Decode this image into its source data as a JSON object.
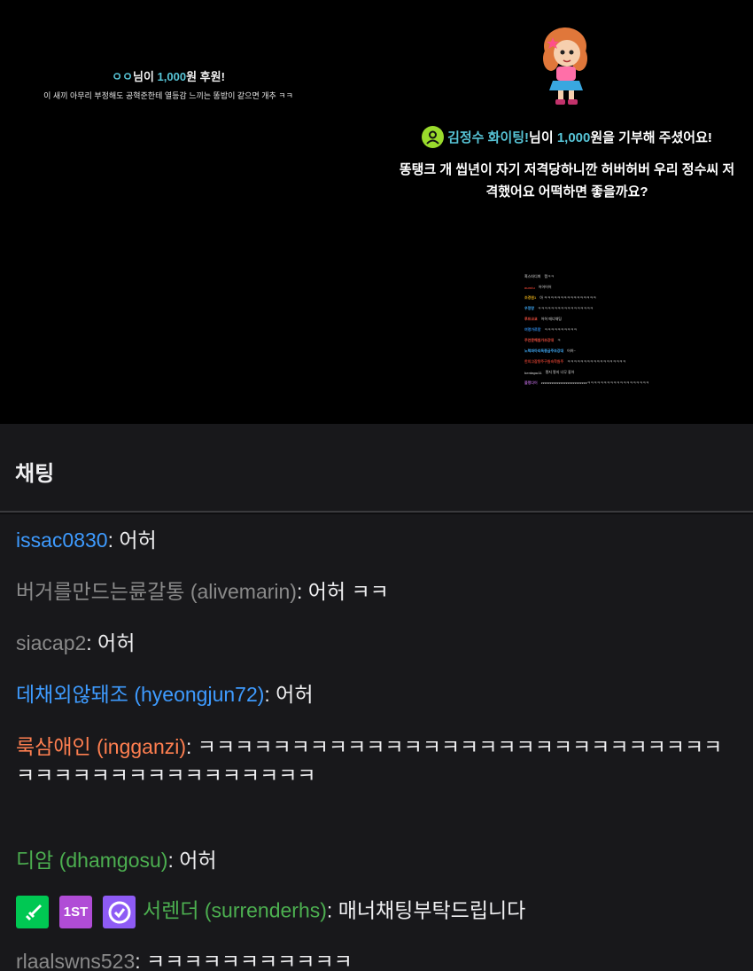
{
  "stream": {
    "alert_left": {
      "name": "ㅇㅇ",
      "mid": "님이 ",
      "amount": "1,000",
      "suffix": "원 후원!",
      "message": "이 새끼 아무리 부정해도 공혁준한테 열등감 느끼는 똥밥이 같으면 개추 ㅋㅋ"
    },
    "alert_right": {
      "name": "김정수 화이팅!",
      "mid": "님이 ",
      "amount": "1,000",
      "suffix": "원을 기부해 주셨어요!",
      "message": "똥탱크 개 씹년이 자기 저격당하니깐 허버허버 우리 정수씨 저격했어요 어떡하면 좋을까요?"
    },
    "mini_chat": [
      {
        "name": "흑스타디퍼",
        "text": "캠ㅋㅋ",
        "color": "#9a9a9a"
      },
      {
        "name": "aumiu",
        "text": "어어어어",
        "color": "#c0392b"
      },
      {
        "name": "조경원1",
        "text": "아 ㅋㅋㅋㅋㅋㅋㅋㅋㅋㅋㅋㅋㅋㅋㅋㅋ",
        "color": "#d4a017"
      },
      {
        "name": "우정랑",
        "text": "ㅋㅋㅋㅋㅋㅋㅋㅋㅋㅋㅋㅋㅋㅋㅋㅋㅋ",
        "color": "#3fa9f5"
      },
      {
        "name": "루프코쿄",
        "text": "어허 매너채팅",
        "color": "#e74c3c"
      },
      {
        "name": "여명가르망",
        "text": "ㅋㅋㅋㅋㅋㅋㅋㅋㅋㅋ",
        "color": "#2e86de"
      },
      {
        "name": "주연문해원가조강대",
        "text": "ㅋ",
        "color": "#e74c3c"
      },
      {
        "name": "노력파아리독종금주조강대",
        "text": "어허~",
        "color": "#3fa9f5"
      },
      {
        "name": "한의고잡탕주구원숙학원주",
        "text": "ㅋㅋㅋㅋㅋㅋㅋㅋㅋㅋㅋㅋㅋㅋㅋㅋㅋㅋ",
        "color": "#c0392b"
      },
      {
        "name": "kentapu11",
        "text": "짱지 짱지 너무 좋아",
        "color": "#aaaaaa"
      },
      {
        "name": "블랭다어",
        "text": "zzzzzzzzzzzzzzzzzzzzzzzzzzㅋㅋㅋㅋㅋㅋㅋㅋㅋㅋㅋㅋㅋㅋㅋㅋㅋㅋㅋ",
        "color": "#9b59b6"
      }
    ]
  },
  "chat": {
    "title": "채팅",
    "messages": [
      {
        "user": "issac0830",
        "color": "#3e9bff",
        "text": ": 어허"
      },
      {
        "user": "버거를만드는륜갈통 (alivemarin)",
        "color": "#8a8a8a",
        "text": ": 어허 ㅋㅋ"
      },
      {
        "user": "siacap2",
        "color": "#8a8a8a",
        "text": ": 어허"
      },
      {
        "user": "데채외않돼조 (hyeongjun72)",
        "color": "#3e9bff",
        "text": ": 어허"
      },
      {
        "user": "룩삼애인 (ingganzi)",
        "color": "#ff7f50",
        "text": ": ㅋㅋㅋㅋㅋㅋㅋㅋㅋㅋㅋㅋㅋㅋㅋㅋㅋㅋㅋㅋㅋㅋㅋㅋㅋㅋㅋㅋㅋㅋㅋㅋㅋㅋㅋㅋㅋㅋㅋㅋㅋㅋㅋㅋ"
      },
      {
        "user": "디암 (dhamgosu)",
        "color": "#4caf50",
        "text": ": 어허"
      },
      {
        "user": "서렌더 (surrenderhs)",
        "color": "#4caf50",
        "text": ": 매너채팅부탁드립니다"
      },
      {
        "user": "rlaalswns523",
        "color": "#8a8a8a",
        "text": ": ㅋㅋㅋㅋㅋㅋㅋㅋㅋㅋㅋ"
      }
    ],
    "badges": {
      "sword_color": "#00c853",
      "first_color": "#b04cd6",
      "first_label": "1ST",
      "verified_color": "#8e5bf5"
    }
  }
}
